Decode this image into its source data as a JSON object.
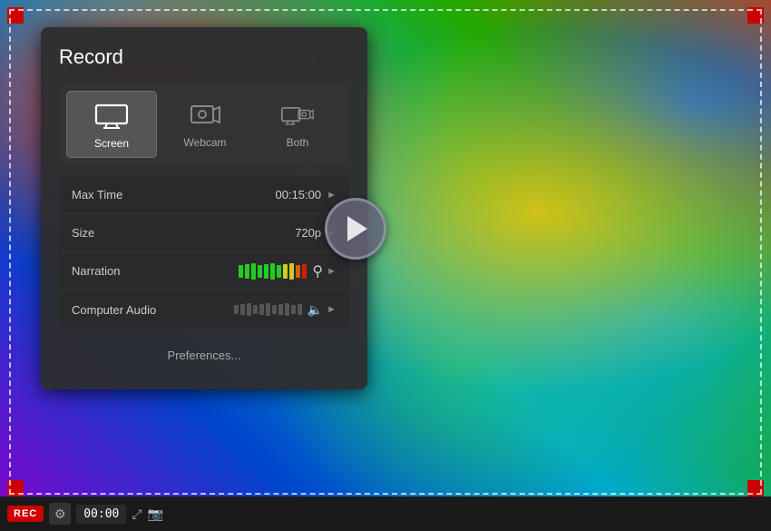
{
  "panel": {
    "title": "Record",
    "sources": [
      {
        "id": "screen",
        "label": "Screen",
        "active": true
      },
      {
        "id": "webcam",
        "label": "Webcam",
        "active": false
      },
      {
        "id": "both",
        "label": "Both",
        "active": false
      }
    ],
    "settings": [
      {
        "id": "maxtime",
        "label": "Max Time",
        "value": "00:15:00",
        "hasChevron": true
      },
      {
        "id": "size",
        "label": "Size",
        "value": "720p",
        "hasChevron": true
      },
      {
        "id": "narration",
        "label": "Narration",
        "value": "",
        "hasChevron": true,
        "hasMeter": true,
        "meterType": "color"
      },
      {
        "id": "compAudio",
        "label": "Computer Audio",
        "value": "",
        "hasChevron": true,
        "hasMeter": true,
        "meterType": "gray"
      }
    ],
    "prefsBtn": "Preferences..."
  },
  "toolbar": {
    "recLabel": "REC",
    "timer": "00:00"
  }
}
